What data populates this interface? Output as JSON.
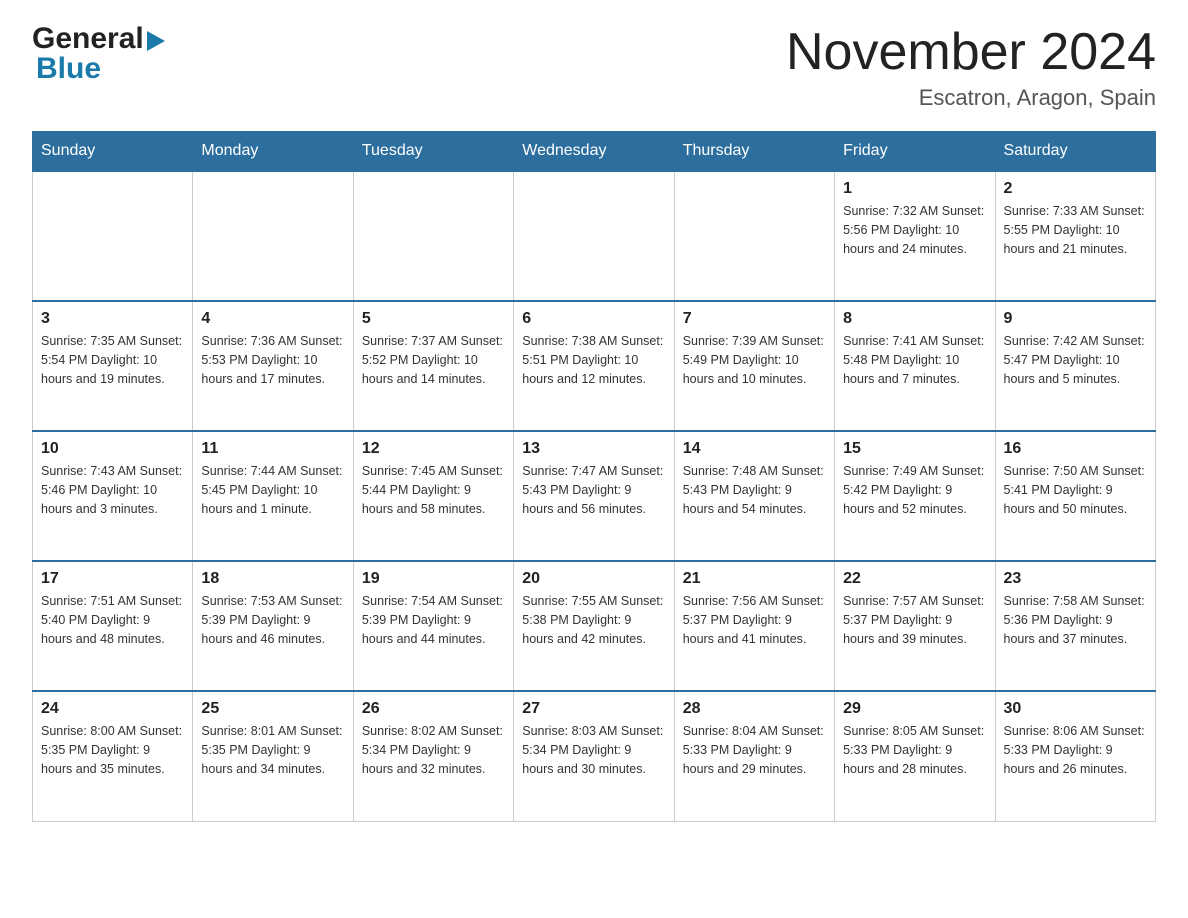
{
  "header": {
    "logo": {
      "line1": "General",
      "line2": "Blue"
    },
    "month": "November 2024",
    "location": "Escatron, Aragon, Spain"
  },
  "weekdays": [
    "Sunday",
    "Monday",
    "Tuesday",
    "Wednesday",
    "Thursday",
    "Friday",
    "Saturday"
  ],
  "rows": [
    [
      {
        "day": "",
        "info": ""
      },
      {
        "day": "",
        "info": ""
      },
      {
        "day": "",
        "info": ""
      },
      {
        "day": "",
        "info": ""
      },
      {
        "day": "",
        "info": ""
      },
      {
        "day": "1",
        "info": "Sunrise: 7:32 AM\nSunset: 5:56 PM\nDaylight: 10 hours\nand 24 minutes."
      },
      {
        "day": "2",
        "info": "Sunrise: 7:33 AM\nSunset: 5:55 PM\nDaylight: 10 hours\nand 21 minutes."
      }
    ],
    [
      {
        "day": "3",
        "info": "Sunrise: 7:35 AM\nSunset: 5:54 PM\nDaylight: 10 hours\nand 19 minutes."
      },
      {
        "day": "4",
        "info": "Sunrise: 7:36 AM\nSunset: 5:53 PM\nDaylight: 10 hours\nand 17 minutes."
      },
      {
        "day": "5",
        "info": "Sunrise: 7:37 AM\nSunset: 5:52 PM\nDaylight: 10 hours\nand 14 minutes."
      },
      {
        "day": "6",
        "info": "Sunrise: 7:38 AM\nSunset: 5:51 PM\nDaylight: 10 hours\nand 12 minutes."
      },
      {
        "day": "7",
        "info": "Sunrise: 7:39 AM\nSunset: 5:49 PM\nDaylight: 10 hours\nand 10 minutes."
      },
      {
        "day": "8",
        "info": "Sunrise: 7:41 AM\nSunset: 5:48 PM\nDaylight: 10 hours\nand 7 minutes."
      },
      {
        "day": "9",
        "info": "Sunrise: 7:42 AM\nSunset: 5:47 PM\nDaylight: 10 hours\nand 5 minutes."
      }
    ],
    [
      {
        "day": "10",
        "info": "Sunrise: 7:43 AM\nSunset: 5:46 PM\nDaylight: 10 hours\nand 3 minutes."
      },
      {
        "day": "11",
        "info": "Sunrise: 7:44 AM\nSunset: 5:45 PM\nDaylight: 10 hours\nand 1 minute."
      },
      {
        "day": "12",
        "info": "Sunrise: 7:45 AM\nSunset: 5:44 PM\nDaylight: 9 hours\nand 58 minutes."
      },
      {
        "day": "13",
        "info": "Sunrise: 7:47 AM\nSunset: 5:43 PM\nDaylight: 9 hours\nand 56 minutes."
      },
      {
        "day": "14",
        "info": "Sunrise: 7:48 AM\nSunset: 5:43 PM\nDaylight: 9 hours\nand 54 minutes."
      },
      {
        "day": "15",
        "info": "Sunrise: 7:49 AM\nSunset: 5:42 PM\nDaylight: 9 hours\nand 52 minutes."
      },
      {
        "day": "16",
        "info": "Sunrise: 7:50 AM\nSunset: 5:41 PM\nDaylight: 9 hours\nand 50 minutes."
      }
    ],
    [
      {
        "day": "17",
        "info": "Sunrise: 7:51 AM\nSunset: 5:40 PM\nDaylight: 9 hours\nand 48 minutes."
      },
      {
        "day": "18",
        "info": "Sunrise: 7:53 AM\nSunset: 5:39 PM\nDaylight: 9 hours\nand 46 minutes."
      },
      {
        "day": "19",
        "info": "Sunrise: 7:54 AM\nSunset: 5:39 PM\nDaylight: 9 hours\nand 44 minutes."
      },
      {
        "day": "20",
        "info": "Sunrise: 7:55 AM\nSunset: 5:38 PM\nDaylight: 9 hours\nand 42 minutes."
      },
      {
        "day": "21",
        "info": "Sunrise: 7:56 AM\nSunset: 5:37 PM\nDaylight: 9 hours\nand 41 minutes."
      },
      {
        "day": "22",
        "info": "Sunrise: 7:57 AM\nSunset: 5:37 PM\nDaylight: 9 hours\nand 39 minutes."
      },
      {
        "day": "23",
        "info": "Sunrise: 7:58 AM\nSunset: 5:36 PM\nDaylight: 9 hours\nand 37 minutes."
      }
    ],
    [
      {
        "day": "24",
        "info": "Sunrise: 8:00 AM\nSunset: 5:35 PM\nDaylight: 9 hours\nand 35 minutes."
      },
      {
        "day": "25",
        "info": "Sunrise: 8:01 AM\nSunset: 5:35 PM\nDaylight: 9 hours\nand 34 minutes."
      },
      {
        "day": "26",
        "info": "Sunrise: 8:02 AM\nSunset: 5:34 PM\nDaylight: 9 hours\nand 32 minutes."
      },
      {
        "day": "27",
        "info": "Sunrise: 8:03 AM\nSunset: 5:34 PM\nDaylight: 9 hours\nand 30 minutes."
      },
      {
        "day": "28",
        "info": "Sunrise: 8:04 AM\nSunset: 5:33 PM\nDaylight: 9 hours\nand 29 minutes."
      },
      {
        "day": "29",
        "info": "Sunrise: 8:05 AM\nSunset: 5:33 PM\nDaylight: 9 hours\nand 28 minutes."
      },
      {
        "day": "30",
        "info": "Sunrise: 8:06 AM\nSunset: 5:33 PM\nDaylight: 9 hours\nand 26 minutes."
      }
    ]
  ]
}
